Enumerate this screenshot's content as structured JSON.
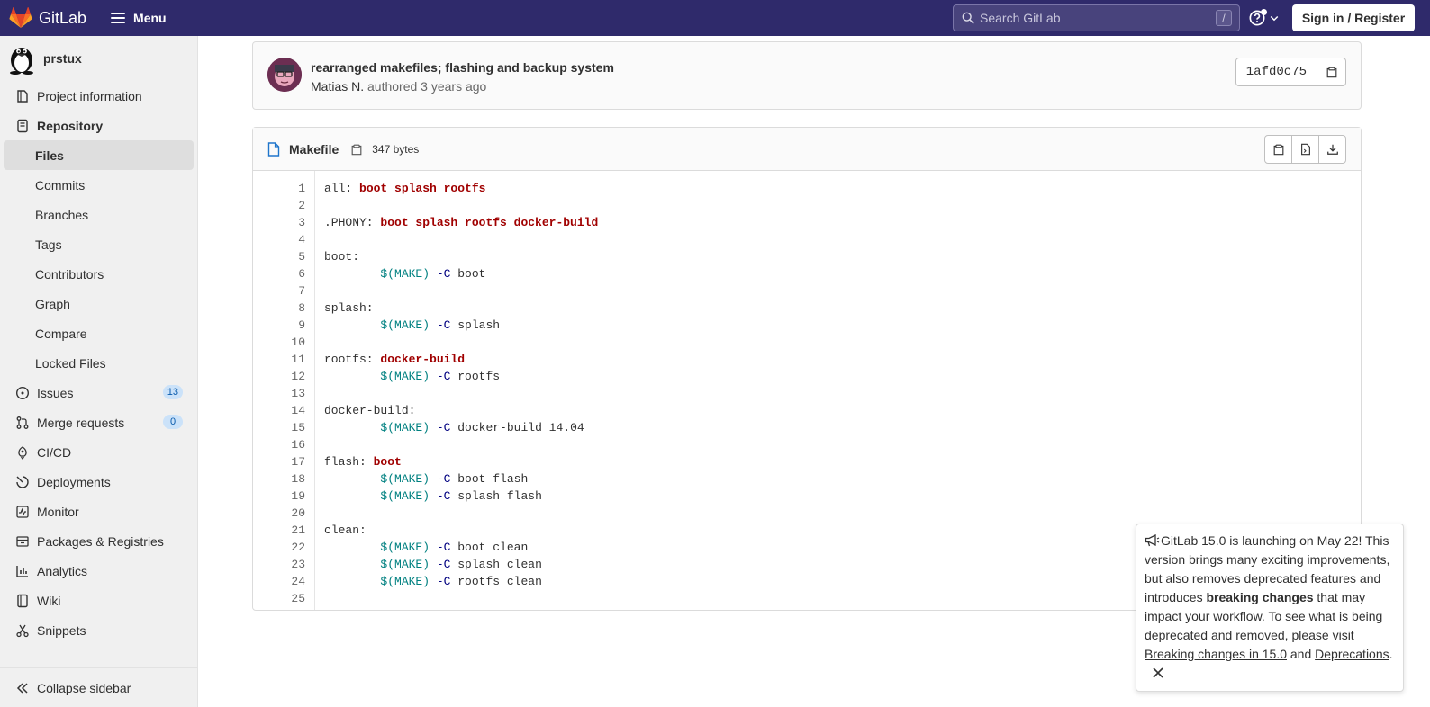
{
  "navbar": {
    "brand": "GitLab",
    "menu_label": "Menu",
    "search_placeholder": "Search GitLab",
    "search_shortcut": "/",
    "signin_label": "Sign in / Register"
  },
  "sidebar": {
    "project_name": "prstux",
    "items": [
      {
        "label": "Project information",
        "icon": "project-icon"
      },
      {
        "label": "Repository",
        "icon": "repository-icon"
      },
      {
        "label": "Files",
        "sub": true,
        "active": true
      },
      {
        "label": "Commits",
        "sub": true
      },
      {
        "label": "Branches",
        "sub": true
      },
      {
        "label": "Tags",
        "sub": true
      },
      {
        "label": "Contributors",
        "sub": true
      },
      {
        "label": "Graph",
        "sub": true
      },
      {
        "label": "Compare",
        "sub": true
      },
      {
        "label": "Locked Files",
        "sub": true
      },
      {
        "label": "Issues",
        "icon": "issues-icon",
        "badge": "13"
      },
      {
        "label": "Merge requests",
        "icon": "merge-request-icon",
        "badge": "0"
      },
      {
        "label": "CI/CD",
        "icon": "rocket-icon"
      },
      {
        "label": "Deployments",
        "icon": "deployments-icon"
      },
      {
        "label": "Monitor",
        "icon": "monitor-icon"
      },
      {
        "label": "Packages & Registries",
        "icon": "package-icon"
      },
      {
        "label": "Analytics",
        "icon": "chart-icon"
      },
      {
        "label": "Wiki",
        "icon": "book-icon"
      },
      {
        "label": "Snippets",
        "icon": "snippet-icon"
      }
    ],
    "collapse_label": "Collapse sidebar"
  },
  "commit": {
    "title": "rearranged makefiles; flashing and backup system",
    "author": "Matias N.",
    "meta_rest": "authored 3 years ago",
    "sha": "1afd0c75"
  },
  "file": {
    "name": "Makefile",
    "size": "347 bytes",
    "lines": [
      "1",
      "2",
      "3",
      "4",
      "5",
      "6",
      "7",
      "8",
      "9",
      "10",
      "11",
      "12",
      "13",
      "14",
      "15",
      "16",
      "17",
      "18",
      "19",
      "20",
      "21",
      "22",
      "23",
      "24",
      "25"
    ]
  },
  "broadcast": {
    "text_1": "GitLab 15.0 is launching on May 22! This version brings many exciting improvements, but also removes deprecated features and introduces ",
    "bold": "breaking changes",
    "text_2": " that may impact your workflow. To see what is being deprecated and removed, please visit ",
    "link_1": "Breaking changes in 15.0",
    "text_3": " and ",
    "link_2": "Deprecations",
    "text_4": "."
  },
  "colors": {
    "navbar": "#2f2a6b",
    "badge_bg": "#cbe2f9",
    "make_target": "#a00000",
    "make_variable": "#008080"
  }
}
